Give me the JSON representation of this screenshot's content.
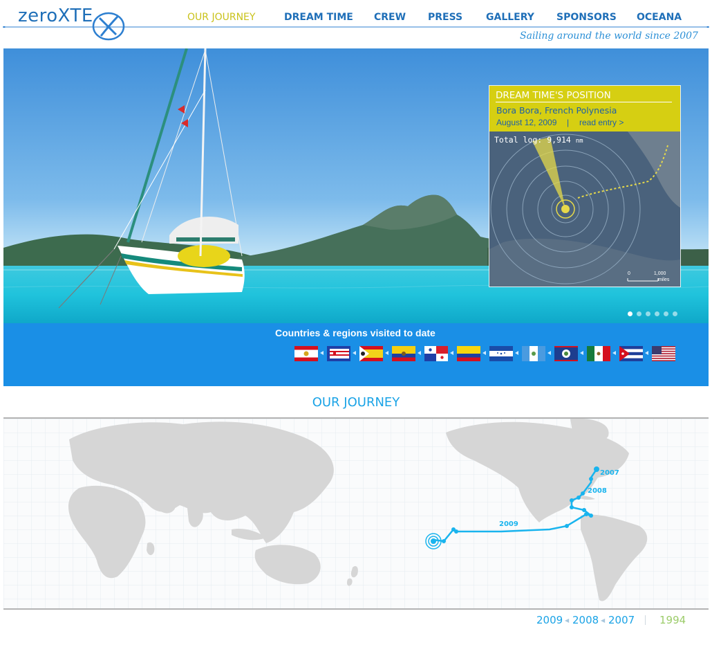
{
  "site": {
    "logo_text": "zeroXTE",
    "tagline": "Sailing around the world since 2007"
  },
  "nav": {
    "items": [
      {
        "label": "OUR JOURNEY",
        "active": true
      },
      {
        "label": "DREAM TIME",
        "active": false
      },
      {
        "label": "CREW",
        "active": false
      },
      {
        "label": "PRESS",
        "active": false
      },
      {
        "label": "GALLERY",
        "active": false
      },
      {
        "label": "SPONSORS",
        "active": false
      },
      {
        "label": "OCEANA",
        "active": false
      }
    ]
  },
  "position": {
    "title": "DREAM TIME'S POSITION",
    "place": "Bora Bora, French Polynesia",
    "date": "August 12, 2009",
    "separator": "|",
    "read_entry": "read entry >",
    "total_log_label": "Total log:",
    "total_log_value": "9,914",
    "total_log_unit": "nm",
    "scale_zero": "0",
    "scale_max": "1,000",
    "scale_unit": "miles"
  },
  "slideshow": {
    "count": 6,
    "active_index": 0
  },
  "countries": {
    "title": "Countries & regions visited to date",
    "flags": [
      {
        "name": "french-polynesia",
        "color": "#d4101e"
      },
      {
        "name": "puerto-rico",
        "color": "#1f3fa6"
      },
      {
        "name": "san-blas-kuna-yala",
        "color": "#f2d21a"
      },
      {
        "name": "ecuador",
        "color": "#f4cf10"
      },
      {
        "name": "panama",
        "color": "#d81e2b"
      },
      {
        "name": "colombia",
        "color": "#f7d60e"
      },
      {
        "name": "honduras",
        "color": "#1a4ca8"
      },
      {
        "name": "guatemala",
        "color": "#4a9be0"
      },
      {
        "name": "belize",
        "color": "#1d3d8f"
      },
      {
        "name": "mexico",
        "color": "#157a3c"
      },
      {
        "name": "cuba",
        "color": "#1f3f9a"
      },
      {
        "name": "united-states",
        "color": "#b22234"
      }
    ]
  },
  "journey": {
    "title": "OUR JOURNEY",
    "route_labels": [
      "2007",
      "2008",
      "2009"
    ],
    "years": [
      "2009",
      "2008",
      "2007",
      "1994"
    ],
    "route_color": "#19b4ee"
  },
  "colors": {
    "brand_blue": "#1f6fb8",
    "accent_yellow": "#d6cf12",
    "countries_band": "#1a8fe6",
    "journey_blue": "#1aa3e6",
    "year_green": "#9ccc6a"
  }
}
